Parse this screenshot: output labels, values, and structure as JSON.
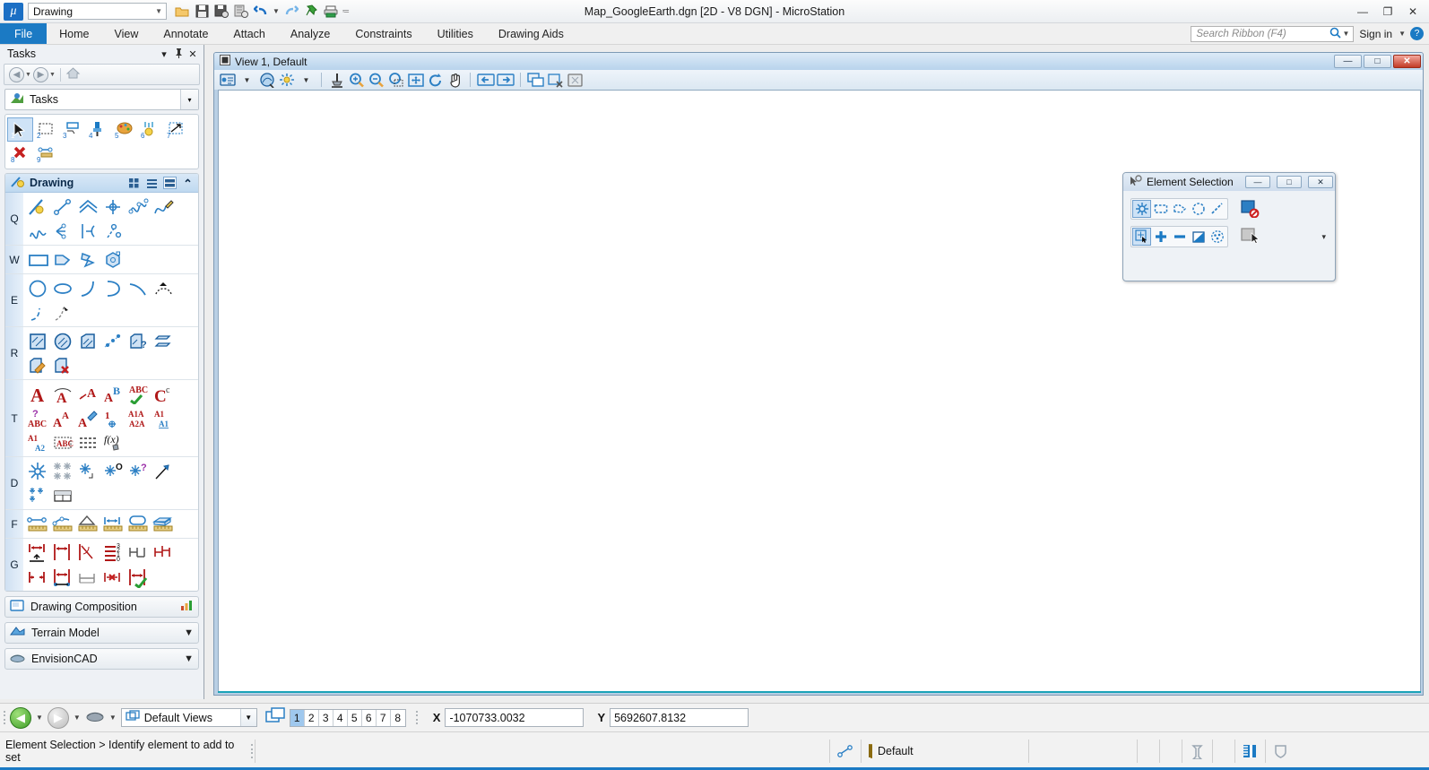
{
  "titlebar": {
    "logo_icon": "microstation-logo-icon",
    "workspace": "Drawing",
    "app_title": "Map_GoogleEarth.dgn [2D - V8 DGN] - MicroStation",
    "quick_access": [
      {
        "name": "open-file-icon",
        "label": "Open"
      },
      {
        "name": "save-icon",
        "label": "Save"
      },
      {
        "name": "save-settings-icon",
        "label": "Save Settings"
      },
      {
        "name": "save-as-icon",
        "label": "Save As"
      },
      {
        "name": "undo-icon",
        "label": "Undo"
      },
      {
        "name": "undo-dropdown-caret",
        "label": "▾"
      },
      {
        "name": "redo-icon",
        "label": "Redo"
      },
      {
        "name": "pin-icon",
        "label": "Pin"
      },
      {
        "name": "print-icon",
        "label": "Print"
      },
      {
        "name": "customize-qat-caret",
        "label": "≔"
      }
    ],
    "window_buttons": [
      {
        "name": "minimize-button",
        "glyph": "—"
      },
      {
        "name": "maximize-button",
        "glyph": "❐"
      },
      {
        "name": "close-button",
        "glyph": "✕"
      }
    ]
  },
  "ribbon": {
    "tabs": [
      {
        "label": "File",
        "active": true
      },
      {
        "label": "Home",
        "active": false
      },
      {
        "label": "View",
        "active": false
      },
      {
        "label": "Annotate",
        "active": false
      },
      {
        "label": "Attach",
        "active": false
      },
      {
        "label": "Analyze",
        "active": false
      },
      {
        "label": "Constraints",
        "active": false
      },
      {
        "label": "Utilities",
        "active": false
      },
      {
        "label": "Drawing Aids",
        "active": false
      }
    ],
    "search_placeholder": "Search Ribbon (F4)",
    "search_value": "",
    "sign_in_label": "Sign in",
    "help_glyph": "?"
  },
  "tasks_panel": {
    "header": {
      "title": "Tasks",
      "controls": [
        {
          "name": "panel-dropdown-icon",
          "glyph": "▾"
        },
        {
          "name": "panel-pin-icon",
          "glyph": "☨"
        },
        {
          "name": "panel-close-icon",
          "glyph": "✕"
        }
      ]
    },
    "nav": {
      "back_label": "◀",
      "forward_label": "▶",
      "home_label": "⌂"
    },
    "task_selector": {
      "label": "Tasks",
      "icon": "tasks-icon",
      "caret": "▾"
    },
    "main_tools": {
      "row1": [
        {
          "num": "1",
          "name": "element-selection-tool",
          "selected": true
        },
        {
          "num": "2",
          "name": "fence-tool",
          "selected": false
        },
        {
          "num": "3",
          "name": "place-note-tool",
          "selected": false
        },
        {
          "num": "4",
          "name": "match-attributes-tool",
          "selected": false
        },
        {
          "num": "5",
          "name": "change-attributes-tool",
          "selected": false
        },
        {
          "num": "6",
          "name": "measure-tool",
          "selected": false
        },
        {
          "num": "7",
          "name": "manipulate-tool",
          "selected": false
        }
      ],
      "row2": [
        {
          "num": "8",
          "name": "delete-element-tool",
          "selected": false
        },
        {
          "num": "9",
          "name": "measure-distance-tool",
          "selected": false
        }
      ]
    },
    "drawing_group": {
      "title": "Drawing",
      "title_icon": "drawing-icon",
      "view_modes": [
        {
          "name": "view-mode-large-icons",
          "selected": false
        },
        {
          "name": "view-mode-list",
          "selected": false
        },
        {
          "name": "view-mode-panel",
          "selected": true
        }
      ],
      "collapse_caret": "⌃",
      "rows": [
        {
          "key": "Q",
          "name": "linear-tools-row",
          "count": 10
        },
        {
          "key": "W",
          "name": "polygon-tools-row",
          "count": 4
        },
        {
          "key": "E",
          "name": "ellipse-arc-tools-row",
          "count": 8
        },
        {
          "key": "R",
          "name": "pattern-tools-row",
          "count": 8
        },
        {
          "key": "T",
          "name": "text-tools-row",
          "count": 16
        },
        {
          "key": "D",
          "name": "cell-point-tools-row",
          "count": 8
        },
        {
          "key": "F",
          "name": "measure-tools-row",
          "count": 6
        },
        {
          "key": "G",
          "name": "dimension-tools-row",
          "count": 12
        }
      ]
    },
    "bottom_items": [
      {
        "label": "Drawing Composition",
        "icon": "drawing-composition-icon",
        "right_icon": "chart-icon"
      },
      {
        "label": "Terrain Model",
        "icon": "terrain-model-icon",
        "right_icon": "chevron-down-icon"
      },
      {
        "label": "EnvisionCAD",
        "icon": "envisioncad-icon",
        "right_icon": "chevron-down-icon"
      }
    ]
  },
  "view_window": {
    "title": "View 1, Default",
    "title_icon": "view-window-icon",
    "buttons": [
      {
        "name": "view-minimize-button",
        "glyph": "—"
      },
      {
        "name": "view-restore-button",
        "glyph": "□"
      },
      {
        "name": "view-close-button",
        "glyph": "✕"
      }
    ],
    "toolbar": [
      {
        "name": "view-attributes-icon"
      },
      {
        "name": "view-attributes-caret",
        "glyph": "▾"
      },
      {
        "name": "view-display-style-icon"
      },
      {
        "name": "view-brightness-icon"
      },
      {
        "name": "view-brightness-caret",
        "glyph": "▾"
      },
      {
        "name": "update-view-icon"
      },
      {
        "name": "zoom-in-icon"
      },
      {
        "name": "zoom-out-icon"
      },
      {
        "name": "window-area-icon"
      },
      {
        "name": "fit-view-icon"
      },
      {
        "name": "rotate-view-icon"
      },
      {
        "name": "pan-view-icon"
      },
      {
        "name": "view-previous-icon"
      },
      {
        "name": "view-next-icon"
      },
      {
        "name": "copy-view-icon"
      },
      {
        "name": "clip-volume-icon"
      },
      {
        "name": "clip-mask-icon"
      }
    ]
  },
  "element_selection_dialog": {
    "title": "Element Selection",
    "title_icon": "element-selection-icon",
    "buttons": [
      {
        "name": "dialog-minimize-button",
        "glyph": "—"
      },
      {
        "name": "dialog-restore-button",
        "glyph": "□"
      },
      {
        "name": "dialog-close-button",
        "glyph": "✕"
      }
    ],
    "method_row": [
      {
        "name": "method-individual-icon",
        "selected": true
      },
      {
        "name": "method-block-icon",
        "selected": false
      },
      {
        "name": "method-shape-icon",
        "selected": false
      },
      {
        "name": "method-circle-icon",
        "selected": false
      },
      {
        "name": "method-line-icon",
        "selected": false
      }
    ],
    "mode_row": [
      {
        "name": "mode-new-icon",
        "selected": true
      },
      {
        "name": "mode-add-icon",
        "selected": false
      },
      {
        "name": "mode-subtract-icon",
        "selected": false
      },
      {
        "name": "mode-invert-icon",
        "selected": false
      },
      {
        "name": "mode-clear-icon",
        "selected": false
      }
    ],
    "extra": [
      {
        "name": "no-selection-indicator-icon"
      },
      {
        "name": "selection-pointer-icon"
      }
    ],
    "expand_caret": "▾"
  },
  "primary_bar": {
    "nav_back_icon": "nav-back-icon",
    "nav_forward_icon": "nav-forward-icon",
    "nav_history_icon": "nav-history-icon",
    "views_combo_label": "Default Views",
    "views_combo_icon": "views-group-icon",
    "view_toggle_icon": "view-groups-icon",
    "view_numbers": [
      {
        "label": "1",
        "selected": true
      },
      {
        "label": "2",
        "selected": false
      },
      {
        "label": "3",
        "selected": false
      },
      {
        "label": "4",
        "selected": false
      },
      {
        "label": "5",
        "selected": false
      },
      {
        "label": "6",
        "selected": false
      },
      {
        "label": "7",
        "selected": false
      },
      {
        "label": "8",
        "selected": false
      }
    ],
    "coord_x": {
      "label": "X",
      "value": "-1070733.0032"
    },
    "coord_y": {
      "label": "Y",
      "value": "5692607.8132"
    }
  },
  "status_bar": {
    "message": "Element Selection > Identify element to add to set",
    "snap_icon": "snap-mode-icon",
    "lock_icon": "lock-icon",
    "level_label": "Default",
    "right_icons": [
      {
        "name": "model-icon"
      },
      {
        "name": "book-icon"
      },
      {
        "name": "shield-icon"
      }
    ]
  }
}
